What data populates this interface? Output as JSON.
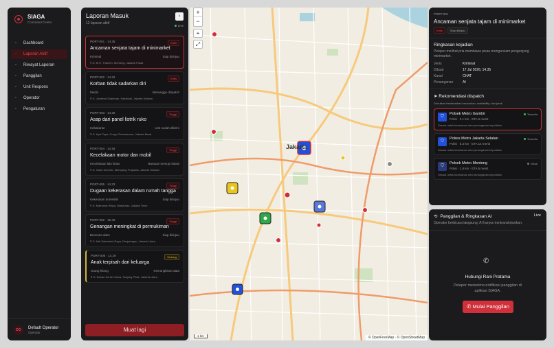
{
  "brand": {
    "name": "SIAGA",
    "subtitle": "Command Center"
  },
  "nav": [
    {
      "label": "Dashboard",
      "icon": "grid-icon",
      "active": false
    },
    {
      "label": "Laporan Aktif",
      "icon": "alert-icon",
      "active": true
    },
    {
      "label": "Riwayat Laporan",
      "icon": "history-icon",
      "active": false
    },
    {
      "label": "Panggilan",
      "icon": "phone-icon",
      "active": false
    },
    {
      "label": "Unit Respons",
      "icon": "shield-icon",
      "active": false
    },
    {
      "label": "Operator",
      "icon": "user-icon",
      "active": false
    },
    {
      "label": "Pengaturan",
      "icon": "gear-icon",
      "active": false
    }
  ],
  "user": {
    "initials": "DO",
    "name": "Default Operator",
    "role": "Operator"
  },
  "reports": {
    "title": "Laporan Masuk",
    "count": "12 laporan aktif",
    "live": "Live",
    "footer": "Muat lagi",
    "items": [
      {
        "id": "PORT-001 · 14.35",
        "title": "Ancaman senjata tajam di minimarket",
        "badge": "Kritis",
        "level": "high",
        "category": "Kriminal",
        "status": "Siap ditinjau",
        "location": "Jl. M.H. Thamrin, Menteng, Jakarta Pusat",
        "selected": true
      },
      {
        "id": "PORT-002 · 14.32",
        "title": "Korban tidak sadarkan diri",
        "badge": "Kritis",
        "level": "high",
        "category": "Medis",
        "status": "Menunggu dispatch",
        "location": "Jl. Jenderal Sudirman, Setiabudi, Jakarta Selatan",
        "selected": false
      },
      {
        "id": "PORT-003 · 14.30",
        "title": "Asap dari panel listrik ruko",
        "badge": "Tinggi",
        "level": "high",
        "category": "Kebakaran",
        "status": "Unit sudah dikirim",
        "location": "Jl. Kyai Tapa, Grogol Petamburan, Jakarta Barat",
        "selected": false
      },
      {
        "id": "PORT-004 · 14.26",
        "title": "Kecelakaan motor dan mobil",
        "badge": "Tinggi",
        "level": "high",
        "category": "Kecelakaan lalu lintas",
        "status": "Bantuan menuju lokasi",
        "location": "Jl. Gatot Subroto, Mampang Prapatan, Jakarta Selatan",
        "selected": false
      },
      {
        "id": "PORT-005 · 14.23",
        "title": "Dugaan kekerasan dalam rumah tangga",
        "badge": "Tinggi",
        "level": "high",
        "category": "Kekerasan domestik",
        "status": "Siap ditinjau",
        "location": "Jl. Matraman Raya, Matraman, Jakarta Timur",
        "selected": false
      },
      {
        "id": "PORT-002 · 15.49",
        "title": "Genangan meningkat di permukiman",
        "badge": "Tinggi",
        "level": "high",
        "category": "Bencana alam",
        "status": "Siap ditinjau",
        "location": "Jl. Kali Sekretaris Raya, Penjaringan, Jakarta Utara",
        "selected": false
      },
      {
        "id": "PORT-006 · 14.19",
        "title": "Anak terpisah dari keluarga",
        "badge": "Sedang",
        "level": "mid",
        "category": "Orang hilang",
        "status": "Kemungkinan data",
        "location": "Jl. Danau Sunter Utara, Tanjung Priok, Jakarta Utara",
        "selected": false
      }
    ]
  },
  "map": {
    "zoom_in": "+",
    "zoom_out": "−",
    "city_label": "Jakarta",
    "scale": "1 km",
    "attribution": "© OpenFreeMap · © OpenStreetMap"
  },
  "detail": {
    "id": "PORT-001",
    "title": "Ancaman senjata tajam di minimarket",
    "badges": [
      "Kritis",
      "Siap ditinjau"
    ],
    "summary_heading": "Ringkasan kejadian",
    "summary": "Pelapor melihat pria membawa pisau mengancam pengunjung minimarket.",
    "fields": [
      {
        "k": "Jenis",
        "v": "Kriminal"
      },
      {
        "k": "Dibuat",
        "v": "17 Jul 2026, 14.35"
      },
      {
        "k": "Kanal",
        "v": "CHAT"
      },
      {
        "k": "Penanganan",
        "v": "AI"
      }
    ],
    "dispatch_heading": "Rekomendasi dispatch",
    "dispatch_sub": "Diurutkan berdasarkan kecocokan, availability, dan jarak.",
    "units": [
      {
        "name": "Polsek Metro Gambir",
        "meta": "Polisi · 2.1 km · ETA 6 menit",
        "state": "Tersedia",
        "note": "Sesuai untuk keamanan dan penanganan kepolisian",
        "selected": true,
        "available": true
      },
      {
        "name": "Polres Metro Jakarta Selatan",
        "meta": "Polisi · 5.3 km · ETA 14 menit",
        "state": "Tersedia",
        "note": "Sesuai untuk keamanan dan penanganan kepolisian",
        "selected": false,
        "available": true
      },
      {
        "name": "Polsek Metro Menteng",
        "meta": "Polisi · 1.8 km · ETA 5 menit",
        "state": "Sibuk",
        "note": "Sesuai untuk keamanan dan penanganan kepolisian",
        "selected": false,
        "available": false
      }
    ]
  },
  "call": {
    "heading": "Panggilan & Ringkasan AI",
    "live": "Live",
    "desc": "Operator berbicara langsung; AI hanya mentranskripsikan.",
    "contact": "Hubungi Rani Pratama",
    "contact_desc": "Pelapor menerima notifikasi panggilan di aplikasi SIAGA.",
    "button": "Mulai Panggilan"
  },
  "colors": {
    "accent": "#d0303a",
    "unit_blue": "#2350d8",
    "unit_yellow": "#e8c61a",
    "unit_green": "#2ea84a"
  }
}
